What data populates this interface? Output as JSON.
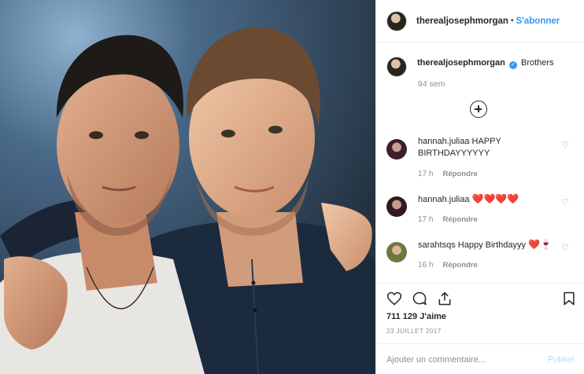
{
  "post": {
    "author": "therealjosephmorgan",
    "follow_label": "S'abonner",
    "separator": "•"
  },
  "caption": {
    "author": "therealjosephmorgan",
    "text": "Brothers",
    "time": "94 sem"
  },
  "comments": [
    {
      "user": "hannah.juliaa",
      "text": "HAPPY BIRTHDAYYYYYY",
      "time": "17 h",
      "reply": "Répondre"
    },
    {
      "user": "hannah.juliaa",
      "text": "",
      "time": "17 h",
      "reply": "Répondre",
      "emoji": "❤️❤️❤️❤️"
    },
    {
      "user": "sarahtsqs",
      "text": "Happy Birthdayyy",
      "time": "16 h",
      "reply": "Répondre",
      "emoji": "❤️🍷"
    }
  ],
  "actions": {
    "likes": "711 129 J'aime",
    "date": "23 JUILLET 2017",
    "comment_placeholder": "Ajouter un commentaire...",
    "publish_label": "Publier"
  },
  "colors": {
    "accent": "#3897f0",
    "muted": "#8e8e8e",
    "heart_red": "#ed1c24"
  },
  "icons": [
    "like-icon",
    "comment-icon",
    "share-icon",
    "bookmark-icon",
    "verified-icon",
    "add-comments-icon"
  ]
}
